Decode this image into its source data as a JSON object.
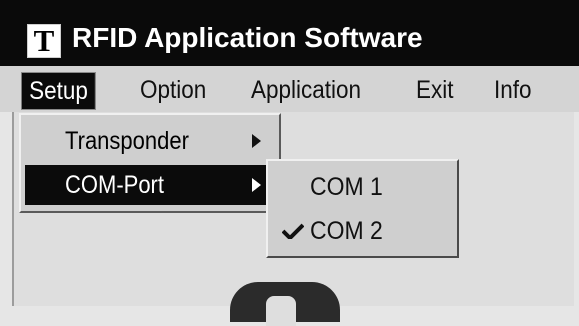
{
  "window": {
    "icon_letter": "T",
    "title": "RFID Application Software"
  },
  "menubar": {
    "items": [
      {
        "label": "Setup"
      },
      {
        "label": "Option"
      },
      {
        "label": "Application"
      },
      {
        "label": "Exit"
      },
      {
        "label": "Info"
      }
    ]
  },
  "setup_menu": {
    "items": [
      {
        "label": "Transponder",
        "has_submenu": true
      },
      {
        "label": "COM-Port",
        "has_submenu": true,
        "selected": true
      }
    ]
  },
  "com_port_submenu": {
    "items": [
      {
        "label": "COM 1",
        "checked": false
      },
      {
        "label": "COM 2",
        "checked": true
      }
    ]
  },
  "colors": {
    "titlebar": "#0a0a0a",
    "menu_bg": "#d4d4d4",
    "highlight": "#0b0b0b",
    "highlight_text": "#ffffff"
  }
}
